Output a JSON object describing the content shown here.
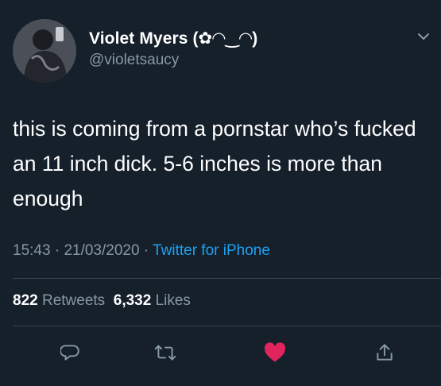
{
  "tweet": {
    "author": {
      "display_name": "Violet Myers (✿◠‿◠)",
      "handle": "@violetsaucy"
    },
    "text": "this is coming from a pornstar who’s fucked an 11 inch dick. 5-6 inches is more than enough",
    "time": "15:43",
    "date": "21/03/2020",
    "source": "Twitter for iPhone",
    "retweets_count": "822",
    "retweets_label": "Retweets",
    "likes_count": "6,332",
    "likes_label": "Likes",
    "liked": true
  },
  "colors": {
    "background": "#15202b",
    "text": "#ffffff",
    "secondary_text": "#8899a6",
    "link": "#1da1f2",
    "like": "#e0245e",
    "divider": "#38444d"
  },
  "icons": {
    "reply": "speech-bubble",
    "retweet": "retweet-arrows",
    "like": "heart-filled",
    "share": "share-arrow-up"
  }
}
